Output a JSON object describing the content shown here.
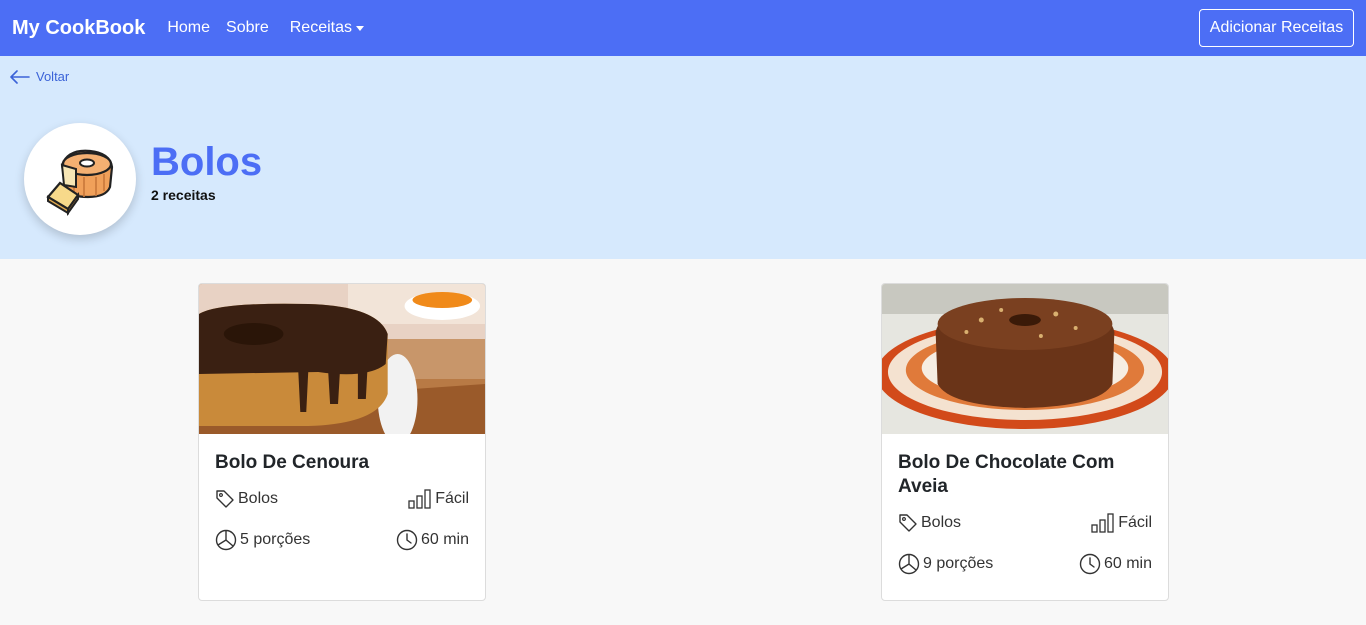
{
  "navbar": {
    "brand": "My CookBook",
    "links": [
      "Home",
      "Sobre"
    ],
    "dropdown_label": "Receitas",
    "add_button": "Adicionar Receitas"
  },
  "hero": {
    "back_label": "Voltar",
    "category_title": "Bolos",
    "recipe_count": "2 receitas",
    "icon": "cake-icon"
  },
  "recipes": [
    {
      "title": "Bolo De Cenoura",
      "category": "Bolos",
      "difficulty": "Fácil",
      "servings": "5 porções",
      "time": "60 min"
    },
    {
      "title": "Bolo De Chocolate Com Aveia",
      "category": "Bolos",
      "difficulty": "Fácil",
      "servings": "9 porções",
      "time": "60 min"
    }
  ],
  "colors": {
    "primary": "#4c6ef5",
    "hero_bg": "#d6e9fd",
    "page_bg": "#f8f8f8",
    "link": "#3b63d8"
  }
}
